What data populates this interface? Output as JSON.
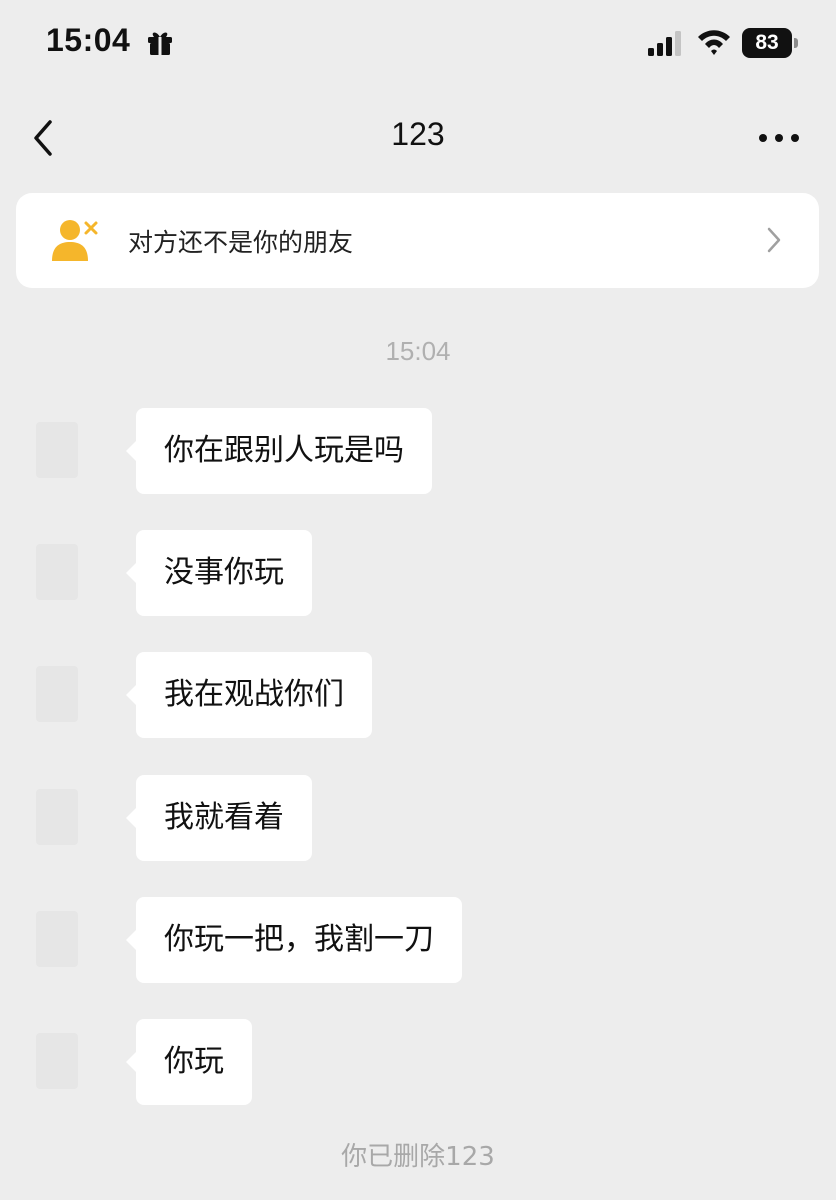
{
  "status_bar": {
    "time": "15:04",
    "battery": "83"
  },
  "nav": {
    "title": "123"
  },
  "banner": {
    "text": "对方还不是你的朋友"
  },
  "chat": {
    "timestamp": "15:04",
    "messages": [
      "你在跟别人玩是吗",
      "没事你玩",
      "我在观战你们",
      "我就看着",
      "你玩一把，我割一刀",
      "你玩"
    ],
    "system_note": "你已删除123"
  },
  "colors": {
    "background": "#ededed",
    "bubble": "#ffffff",
    "banner_icon": "#f5b62b"
  },
  "icons": [
    "gift-icon",
    "signal-icon",
    "wifi-icon",
    "battery-icon",
    "back-icon",
    "more-icon",
    "person-x-icon",
    "chevron-right-icon"
  ]
}
